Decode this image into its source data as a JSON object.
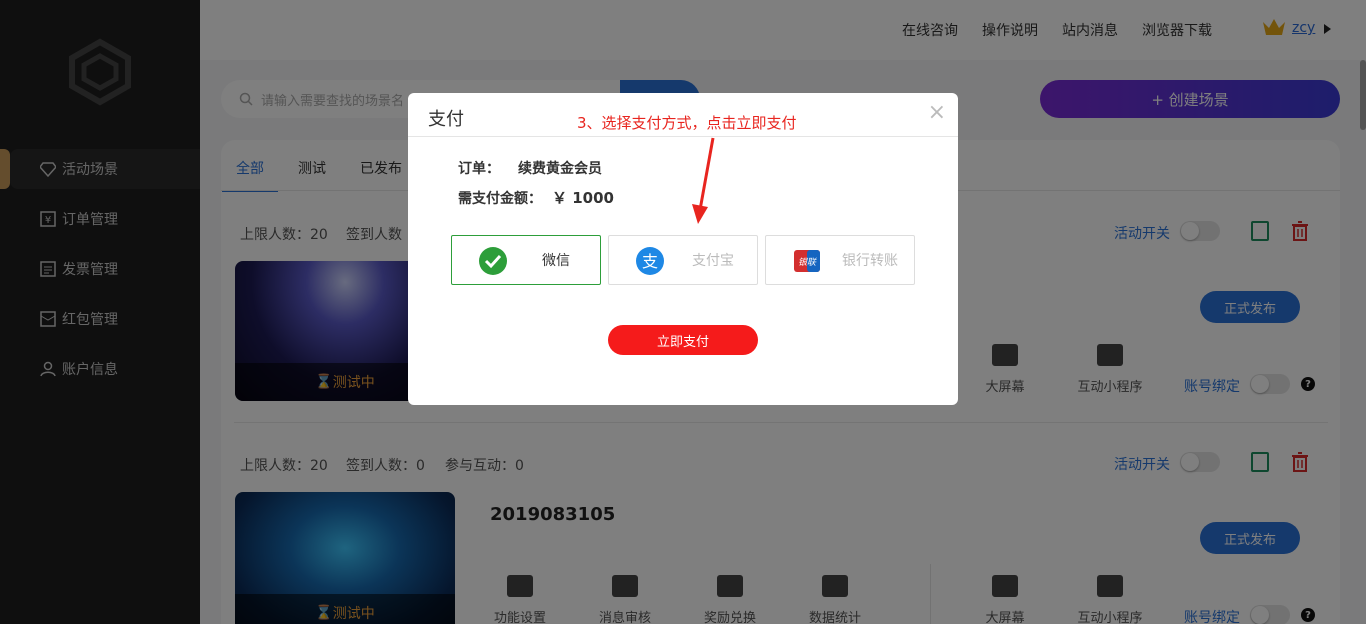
{
  "header": {
    "links": [
      "在线咨询",
      "操作说明",
      "站内消息",
      "浏览器下载"
    ],
    "user": "zcy"
  },
  "sidebar": {
    "items": [
      {
        "label": "活动场景",
        "icon": "diamond-icon",
        "active": true
      },
      {
        "label": "订单管理",
        "icon": "yen-icon"
      },
      {
        "label": "发票管理",
        "icon": "invoice-icon"
      },
      {
        "label": "红包管理",
        "icon": "red-envelope-icon"
      },
      {
        "label": "账户信息",
        "icon": "user-icon"
      }
    ]
  },
  "search": {
    "placeholder": "请输入需要查找的场景名"
  },
  "create_button": "+ 创建场景",
  "tabs": [
    "全部",
    "测试",
    "已发布"
  ],
  "scenes": [
    {
      "limit": "上限人数：20",
      "signed": "签到人数",
      "status": "测试中",
      "switch_label": "活动开关",
      "publish": "正式发布",
      "bind_label": "账号绑定",
      "features_right": [
        "大屏幕",
        "互动小程序"
      ]
    },
    {
      "limit": "上限人数：20",
      "signed": "签到人数：0",
      "interact": "参与互动：0",
      "title": "2019083105",
      "status": "测试中",
      "switch_label": "活动开关",
      "publish": "正式发布",
      "bind_label": "账号绑定",
      "features_left": [
        "功能设置",
        "消息审核",
        "奖励兑换",
        "数据统计"
      ],
      "features_right": [
        "大屏幕",
        "互动小程序"
      ]
    }
  ],
  "modal": {
    "title": "支付",
    "close": "×",
    "note": "3、选择支付方式，点击立即支付",
    "order_label": "订单：",
    "order_value": "续费黄金会员",
    "amount_label": "需支付金额：",
    "amount_value": "￥ 1000",
    "methods": [
      {
        "label": "微信",
        "icon": "wechat-pay-icon",
        "selected": true,
        "color": "#2d9e3a"
      },
      {
        "label": "支付宝",
        "icon": "alipay-icon",
        "selected": false,
        "color": "#1e88e5"
      },
      {
        "label": "银行转账",
        "icon": "unionpay-icon",
        "selected": false,
        "color": "#d32f2f"
      }
    ],
    "pay_button": "立即支付"
  },
  "colors": {
    "accent": "#2b73d9",
    "danger": "#f51b1b",
    "selected": "#2d9e3a",
    "note": "#e8251f"
  }
}
